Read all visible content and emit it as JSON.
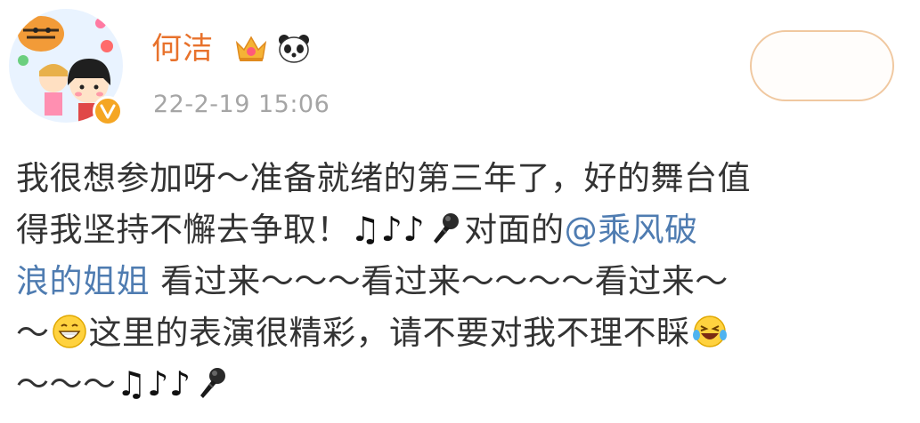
{
  "post": {
    "username": "何洁",
    "timestamp": "22-2-19 15:06",
    "follow_label": "",
    "lines": [
      {
        "segments": [
          {
            "type": "text",
            "text": "我很想参加呀～准备就绪的第三年了，好的舞台值"
          }
        ]
      },
      {
        "segments": [
          {
            "type": "text",
            "text": "得我坚持不懈去争取！"
          },
          {
            "type": "icon",
            "icon": "music-note-icon",
            "glyph": "♫"
          },
          {
            "type": "icon",
            "icon": "music-notes-icon",
            "glyph": "♪♪"
          },
          {
            "type": "icon",
            "icon": "microphone-icon"
          },
          {
            "type": "text",
            "text": "对面的"
          },
          {
            "type": "mention",
            "text": "@乘风破"
          }
        ]
      },
      {
        "segments": [
          {
            "type": "mention",
            "text": "浪的姐姐"
          },
          {
            "type": "text",
            "text": " 看过来～～～看过来～～～～看过来～"
          }
        ]
      },
      {
        "segments": [
          {
            "type": "text",
            "text": "～"
          },
          {
            "type": "icon",
            "icon": "grinning-face-icon"
          },
          {
            "type": "text",
            "text": "这里的表演很精彩，请不要对我不理不睬"
          },
          {
            "type": "icon",
            "icon": "laughing-tears-face-icon"
          }
        ]
      },
      {
        "segments": [
          {
            "type": "text",
            "text": "～～～"
          },
          {
            "type": "icon",
            "icon": "music-note-icon",
            "glyph": "♫"
          },
          {
            "type": "icon",
            "icon": "music-notes-icon",
            "glyph": "♪♪"
          },
          {
            "type": "icon",
            "icon": "microphone-icon"
          }
        ]
      }
    ]
  },
  "colors": {
    "username": "#e8722c",
    "mention": "#4f7cb1",
    "timestamp": "#a5a5a5",
    "text": "#333333",
    "verified_badge": "#f5a623"
  }
}
